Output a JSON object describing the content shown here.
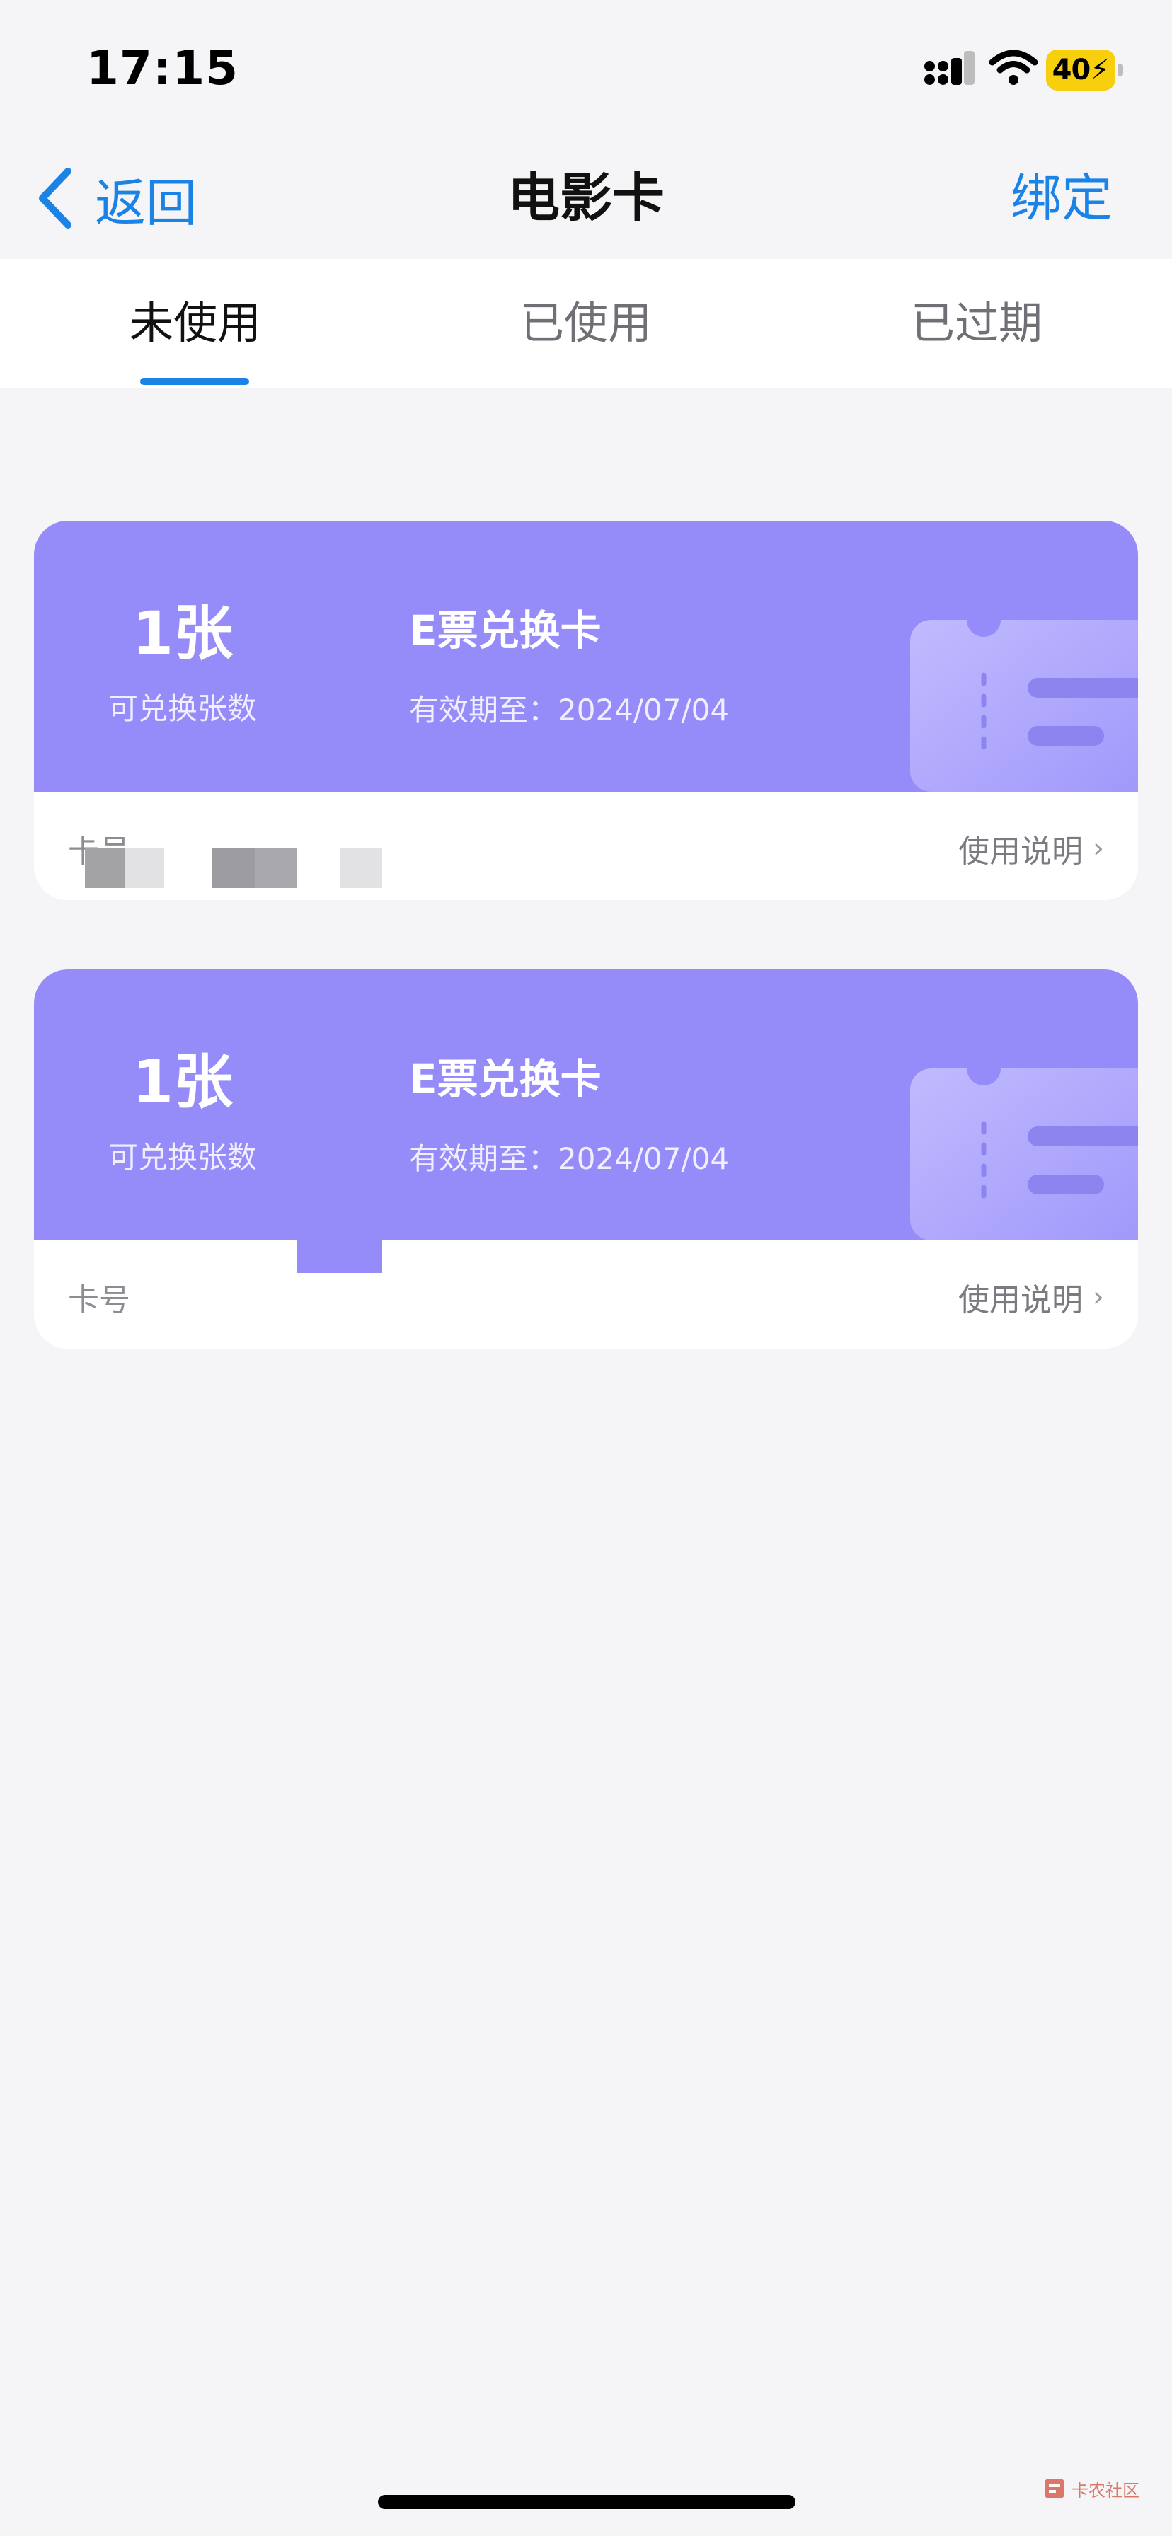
{
  "status_bar": {
    "time": "17:15",
    "battery": "40"
  },
  "nav": {
    "back_label": "返回",
    "title": "电影卡",
    "bind_label": "绑定"
  },
  "tabs": [
    {
      "label": "未使用",
      "active": true
    },
    {
      "label": "已使用",
      "active": false
    },
    {
      "label": "已过期",
      "active": false
    }
  ],
  "cards": [
    {
      "count": "1张",
      "count_label": "可兑换张数",
      "name": "E票兑换卡",
      "expiry": "有效期至：2024/07/04",
      "card_no_label": "卡号",
      "usage_label": "使用说明"
    },
    {
      "count": "1张",
      "count_label": "可兑换张数",
      "name": "E票兑换卡",
      "expiry": "有效期至：2024/07/04",
      "card_no_label": "卡号",
      "usage_label": "使用说明"
    }
  ],
  "watermark": {
    "text": "卡农社区"
  },
  "colors": {
    "accent": "#1b82e6",
    "card_purple": "#958cf9",
    "background": "#f5f5f7",
    "battery": "#f7cf0d"
  }
}
